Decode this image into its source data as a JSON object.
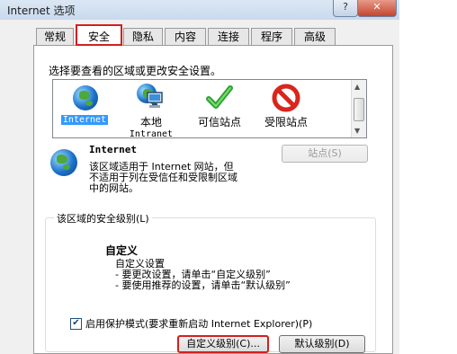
{
  "window": {
    "title": "Internet 选项",
    "help_glyph": "?",
    "close_glyph": "✕"
  },
  "tabs": [
    {
      "label": "常规"
    },
    {
      "label": "安全",
      "active": true
    },
    {
      "label": "隐私"
    },
    {
      "label": "内容"
    },
    {
      "label": "连接"
    },
    {
      "label": "程序"
    },
    {
      "label": "高级"
    }
  ],
  "security": {
    "instruction": "选择要查看的区域或更改安全设置。",
    "zones": [
      {
        "label": "Internet",
        "icon": "globe-icon",
        "selected": true
      },
      {
        "label": "本地",
        "label2": "Intranet",
        "icon": "network-computer-icon"
      },
      {
        "label": "可信站点",
        "icon": "checkmark-icon"
      },
      {
        "label": "受限站点",
        "icon": "prohibited-icon"
      }
    ],
    "zone_title": "Internet",
    "zone_description": [
      "该区域适用于 Internet 网站，但",
      "不适用于列在受信任和受限制区域",
      "中的网站。"
    ],
    "sites_button": "站点(S)",
    "group_label": "该区域的安全级别(L)",
    "level_name": "自定义",
    "level_lines": [
      "自定义设置",
      "- 要更改设置，请单击“自定义级别”",
      "- 要使用推荐的设置，请单击“默认级别”"
    ],
    "protected_mode_label": "启用保护模式(要求重新启动 Internet Explorer)(P)",
    "protected_mode_checked": true,
    "custom_level_button": "自定义级别(C)...",
    "default_level_button": "默认级别(D)"
  },
  "colors": {
    "highlight_border": "#d22020",
    "selection": "#3399ff"
  }
}
